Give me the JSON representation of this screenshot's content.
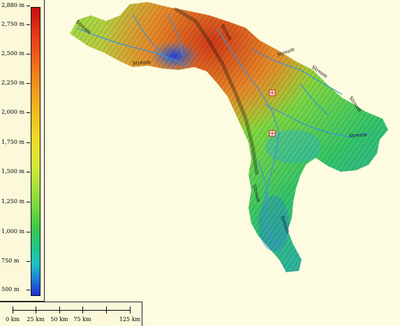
{
  "legend": {
    "labels": [
      "2,880 m",
      "2,750 m",
      "2,500 m",
      "2,250 m",
      "2,000 m",
      "1,750 m",
      "1,500 m",
      "1,250 m",
      "1,000 m",
      "750 m",
      "500 m"
    ]
  },
  "scale_bar": {
    "labels": [
      "0 km",
      "25 km",
      "50 km",
      "75 km",
      "125 km"
    ]
  },
  "map": {
    "stream_labels": [
      "Stream",
      "Stream",
      "Stream",
      "Stream",
      "Stream",
      "Stream",
      "Stream",
      "Stream",
      "Stream"
    ],
    "colors": {
      "high": "#c80f0f",
      "mid": "#eddc2b",
      "low": "#3fca49",
      "lowest": "#1f2fd2",
      "water": "#3d8fe0",
      "background": "#fdfbe0"
    }
  }
}
